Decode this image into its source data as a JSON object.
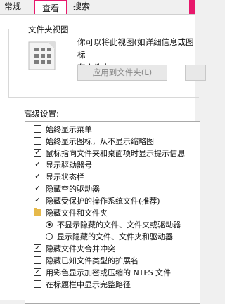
{
  "tabs": {
    "general": "常规",
    "view": "查看",
    "search": "搜索"
  },
  "folder_views": {
    "title": "文件夹视图",
    "description_line1": "你可以将此视图(如详细信息或图标",
    "description_line2": "有文件夹。",
    "apply_button": "应用到文件夹(L)"
  },
  "advanced": {
    "title": "高级设置:",
    "items": [
      {
        "type": "checkbox",
        "checked": false,
        "label": "始终显示菜单"
      },
      {
        "type": "checkbox",
        "checked": false,
        "label": "始终显示图标，从不显示缩略图"
      },
      {
        "type": "checkbox",
        "checked": true,
        "label": "鼠标指向文件夹和桌面项时显示提示信息"
      },
      {
        "type": "checkbox",
        "checked": true,
        "label": "显示驱动器号"
      },
      {
        "type": "checkbox",
        "checked": true,
        "label": "显示状态栏"
      },
      {
        "type": "checkbox",
        "checked": true,
        "label": "隐藏空的驱动器"
      },
      {
        "type": "checkbox",
        "checked": true,
        "label": "隐藏受保护的操作系统文件(推荐)"
      },
      {
        "type": "folder",
        "label": "隐藏文件和文件夹"
      },
      {
        "type": "radio",
        "checked": true,
        "label": "不显示隐藏的文件、文件夹或驱动器"
      },
      {
        "type": "radio",
        "checked": false,
        "label": "显示隐藏的文件、文件夹和驱动器"
      },
      {
        "type": "checkbox",
        "checked": true,
        "label": "隐藏文件夹合并冲突"
      },
      {
        "type": "checkbox",
        "checked": false,
        "label": "隐藏已知文件类型的扩展名"
      },
      {
        "type": "checkbox",
        "checked": true,
        "label": "用彩色显示加密或压缩的 NTFS 文件"
      },
      {
        "type": "checkbox",
        "checked": false,
        "label": "在标题栏中显示完整路径"
      }
    ]
  },
  "colors": {
    "accent": "#e8176b",
    "folder": "#e6b94a"
  }
}
